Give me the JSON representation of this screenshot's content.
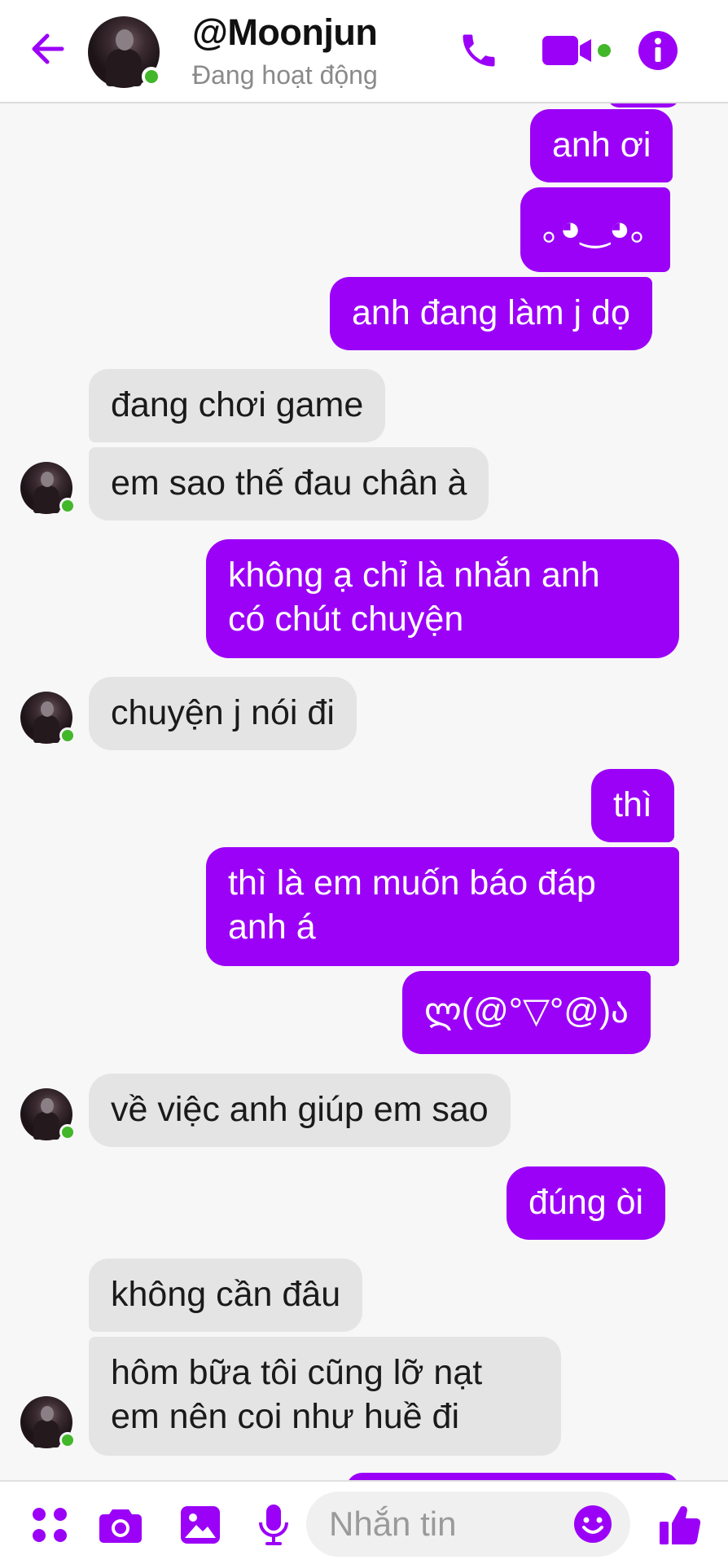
{
  "colors": {
    "accent": "#9b00f7",
    "incoming_bubble": "#e4e4e4",
    "online": "#42b72a"
  },
  "header": {
    "name": "@Moonjun",
    "status": "Đang hoạt động",
    "icons": {
      "back": "arrow-left-icon",
      "call": "phone-icon",
      "video": "video-camera-icon",
      "info": "info-icon"
    }
  },
  "messages": [
    {
      "dir": "out",
      "text": "anh ơi"
    },
    {
      "dir": "out",
      "text": "｡◕‿◕｡"
    },
    {
      "dir": "out",
      "text": "anh đang làm j dọ"
    },
    {
      "dir": "in",
      "text": "đang chơi game"
    },
    {
      "dir": "in",
      "text": "em sao thế đau chân à"
    },
    {
      "dir": "out",
      "text": "không ạ chỉ là nhắn anh\ncó chút chuyện"
    },
    {
      "dir": "in",
      "text": "chuyện j nói đi"
    },
    {
      "dir": "out",
      "text": "thì"
    },
    {
      "dir": "out",
      "text": "thì là em muốn báo đáp\nanh á"
    },
    {
      "dir": "out",
      "text": "ლ(@°▽°@)ა"
    },
    {
      "dir": "in",
      "text": "về việc anh giúp em sao"
    },
    {
      "dir": "out",
      "text": "đúng òi"
    },
    {
      "dir": "in",
      "text": "không cần đâu"
    },
    {
      "dir": "in",
      "text": "hôm bữa tôi cũng lỡ nạt\nem nên coi như huề đi"
    }
  ],
  "composer": {
    "placeholder": "Nhắn tin",
    "icons": [
      "apps-grid-icon",
      "camera-icon",
      "image-icon",
      "microphone-icon",
      "emoji-icon",
      "thumbs-up-icon"
    ]
  }
}
